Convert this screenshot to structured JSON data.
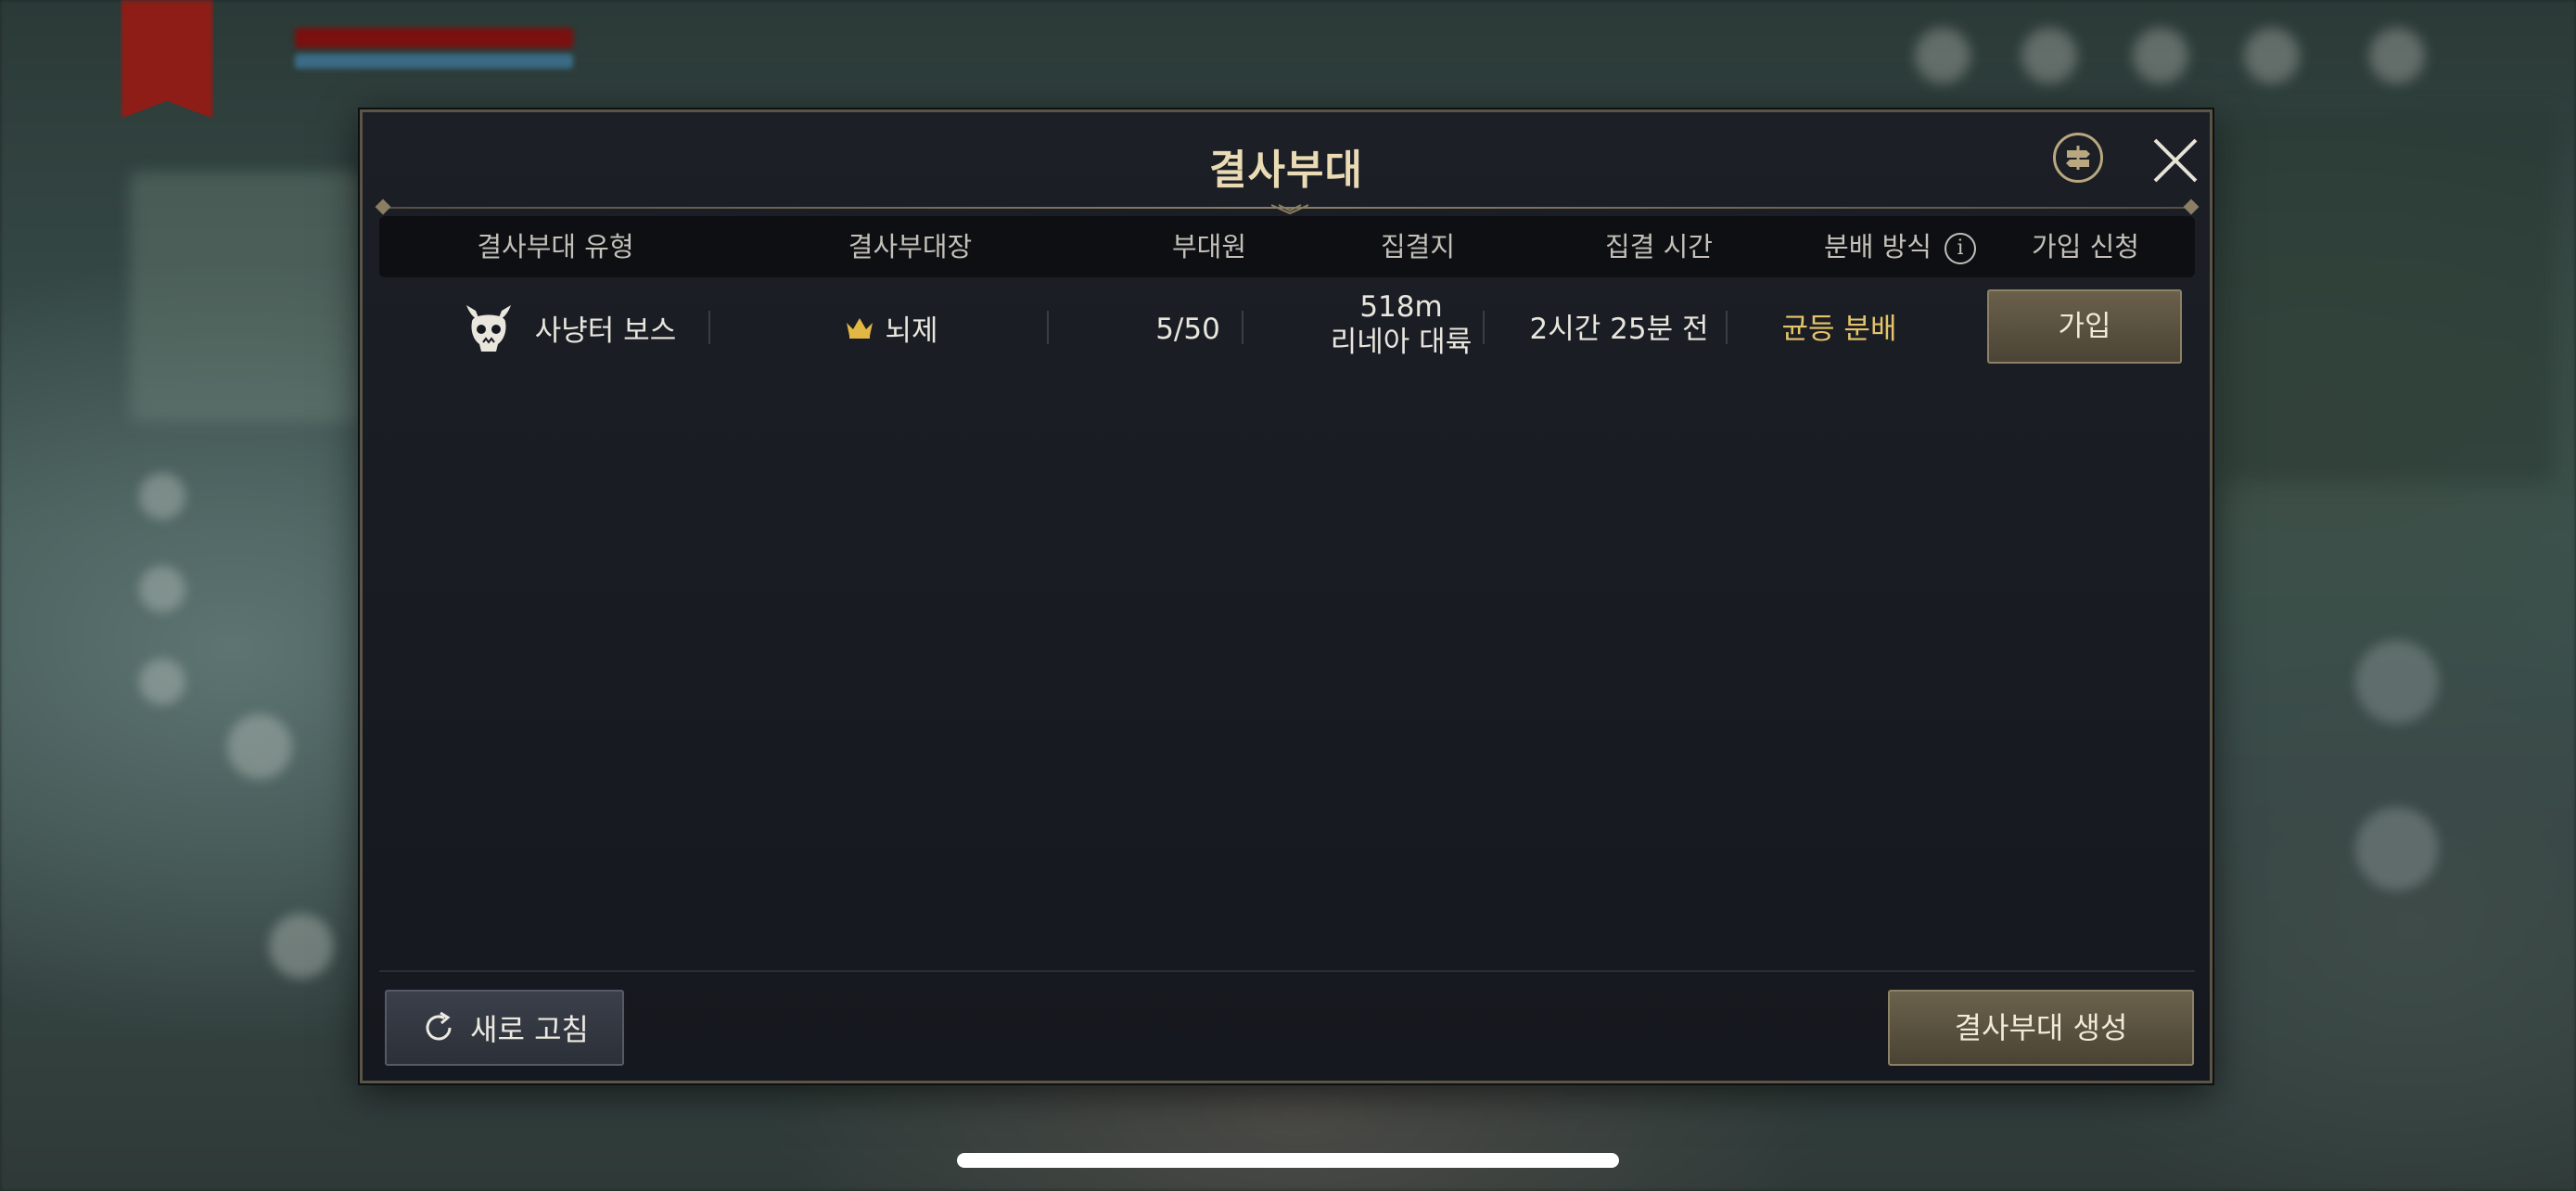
{
  "dialog": {
    "title": "결사부대"
  },
  "table": {
    "headers": {
      "type": "결사부대 유형",
      "leader": "결사부대장",
      "members": "부대원",
      "location": "집결지",
      "time": "집결 시간",
      "distribution": "분배 방식",
      "join": "가입 신청"
    },
    "rows": [
      {
        "type": "사냥터 보스",
        "leader": "뇌제",
        "members": "5/50",
        "distance": "518m",
        "region": "리네아 대륙",
        "time": "2시간 25분 전",
        "distribution": "균등 분배",
        "join_label": "가입"
      }
    ]
  },
  "footer": {
    "refresh_label": "새로 고침",
    "create_label": "결사부대 생성"
  },
  "icons": {
    "guide": "signpost-icon",
    "close": "close-icon",
    "info": "info-icon",
    "boss": "demon-skull-icon",
    "leader": "crown-icon",
    "refresh": "refresh-icon"
  },
  "colors": {
    "accent_gold": "#e5c46a",
    "title": "#eadbb4",
    "button_gold": "#5b5340"
  }
}
